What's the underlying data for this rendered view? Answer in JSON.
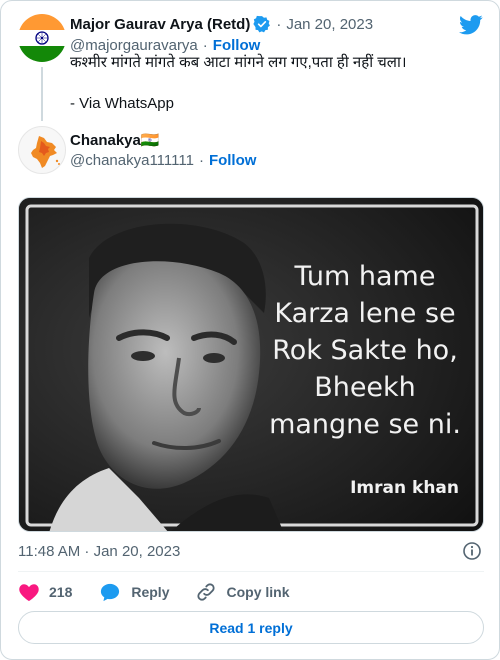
{
  "original": {
    "author_name": "Major Gaurav Arya (Retd)",
    "handle": "@majorgauravarya",
    "follow_label": "Follow",
    "date": "Jan 20, 2023",
    "separator": "·",
    "text_line1": "कश्मीर मांगते मांगते कब आटा मांगने लग गए,पता ही नहीं चला।",
    "text_line2": "- Via WhatsApp"
  },
  "quoted": {
    "author_name": "Chanakya🇮🇳",
    "handle": "@chanakya111111",
    "follow_label": "Follow",
    "separator": "·"
  },
  "media": {
    "caption_lines": [
      "Tum hame",
      "Karza lene se",
      "Rok Sakte ho,",
      "Bheekh",
      "mangne se ni."
    ],
    "signature": "Imran khan"
  },
  "footer": {
    "timestamp": "11:48 AM · Jan 20, 2023",
    "like_count": "218",
    "reply_label": "Reply",
    "copy_link_label": "Copy link",
    "read_replies_label": "Read 1 reply"
  },
  "colors": {
    "accent": "#1d9bf0",
    "like": "#f91880",
    "follow": "#006fd6"
  },
  "icons": [
    "twitter-bird-icon",
    "verified-badge-icon",
    "info-icon",
    "heart-icon",
    "reply-bubble-icon",
    "link-icon"
  ]
}
